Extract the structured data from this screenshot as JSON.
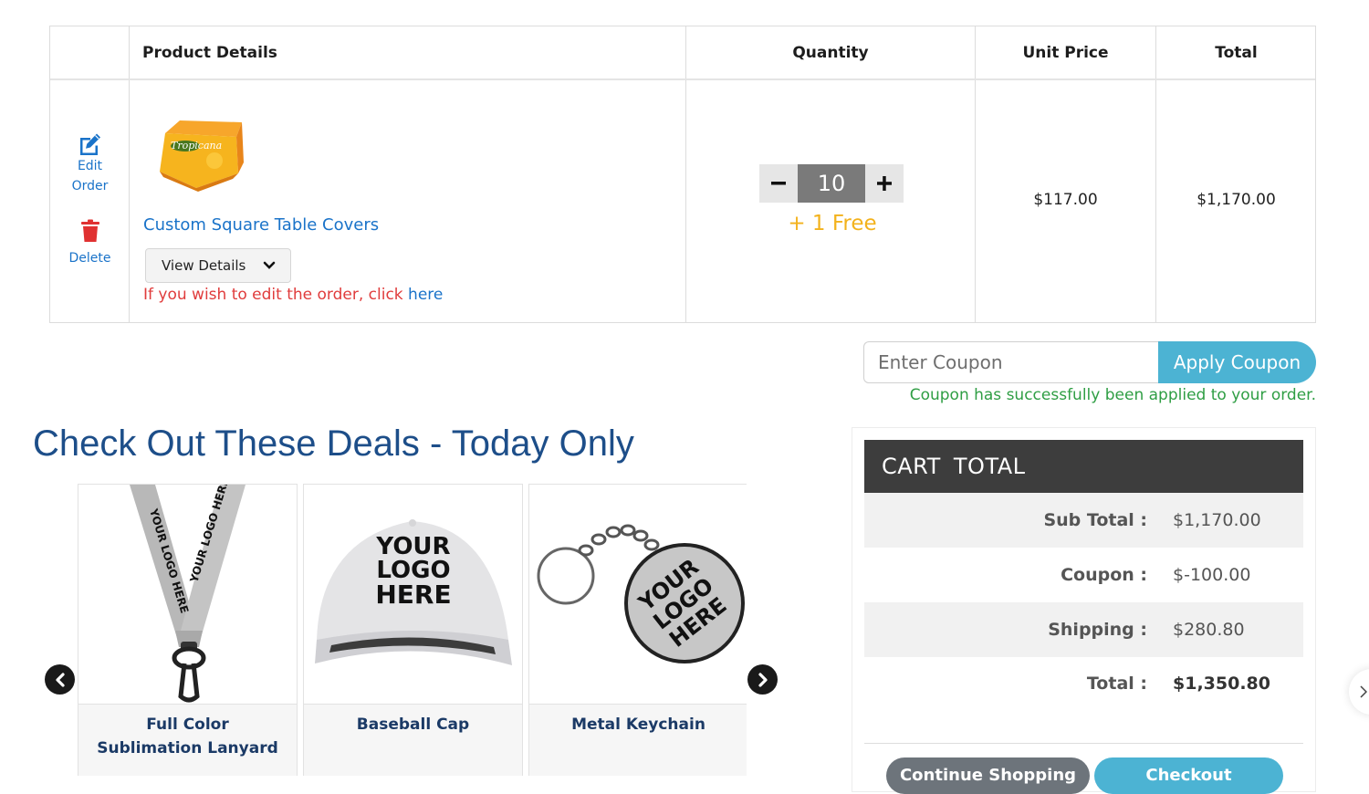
{
  "table": {
    "headers": {
      "product_details": "Product Details",
      "quantity": "Quantity",
      "unit_price": "Unit Price",
      "total": "Total"
    },
    "row": {
      "edit_label_1": "Edit",
      "edit_label_2": "Order",
      "delete_label": "Delete",
      "product_name": "Custom Square Table Covers",
      "view_details": "View Details",
      "edit_note": "If you wish to edit the order, click ",
      "edit_note_link": "here",
      "quantity": "10",
      "free_text": "+ 1 Free",
      "unit_price": "$117.00",
      "total": "$1,170.00"
    }
  },
  "coupon": {
    "placeholder": "Enter Coupon",
    "apply_label": "Apply Coupon",
    "success_message": "Coupon has successfully been applied to your order."
  },
  "deals": {
    "title": "Check Out These Deals - Today Only",
    "items": [
      {
        "name_line1": "Full Color",
        "name_line2": "Sublimation Lanyard"
      },
      {
        "name_line1": "Baseball Cap",
        "name_line2": ""
      },
      {
        "name_line1": "Metal Keychain",
        "name_line2": ""
      }
    ],
    "logo_text": "YOUR LOGO HERE"
  },
  "cart_total": {
    "title": "CART  TOTAL",
    "rows": [
      {
        "label": "Sub Total :",
        "value": "$1,170.00"
      },
      {
        "label": "Coupon :",
        "value": "$-100.00"
      },
      {
        "label": "Shipping :",
        "value": "$280.80"
      },
      {
        "label": "Total :",
        "value": "$1,350.80"
      }
    ],
    "continue_label": "Continue Shopping",
    "checkout_label": "Checkout"
  },
  "colors": {
    "link_blue": "#1a73c9",
    "free_yellow": "#f3b21c",
    "coupon_btn": "#4cb3d3",
    "success_green": "#2f9e44",
    "header_dark": "#3d3d3d",
    "continue_btn": "#6d747b",
    "checkout_btn": "#4cb3d3"
  }
}
